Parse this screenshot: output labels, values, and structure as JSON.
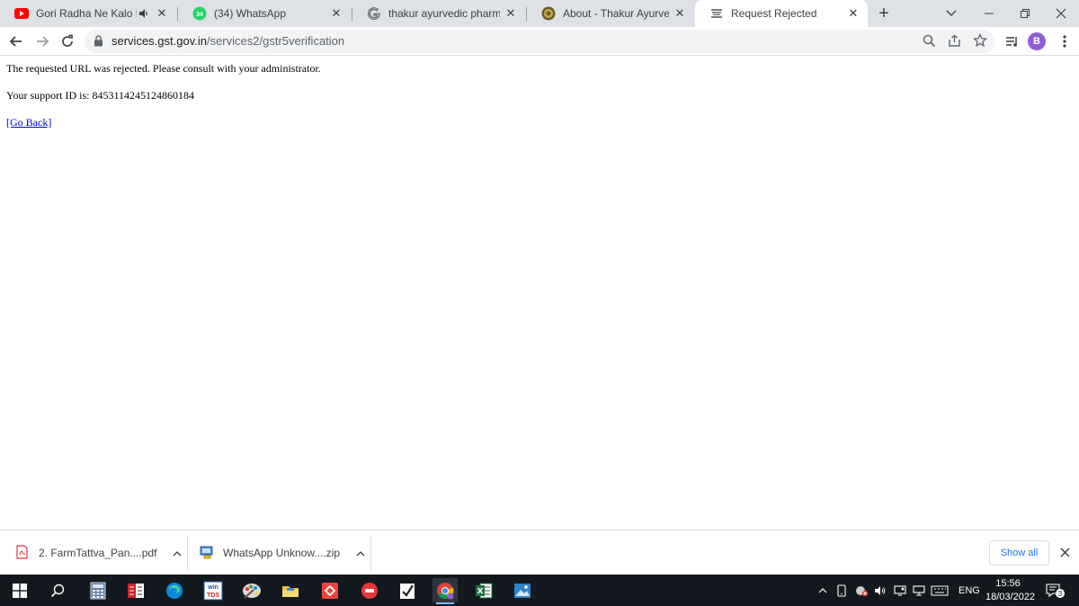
{
  "tabs": [
    {
      "title": "Gori Radha Ne Kalo Kaan"
    },
    {
      "title": "(34) WhatsApp",
      "badge": "34"
    },
    {
      "title": "thakur ayurvedic pharmacy p"
    },
    {
      "title": "About - Thakur Ayurvedic Ph"
    },
    {
      "title": "Request Rejected"
    }
  ],
  "omnibox": {
    "host": "services.gst.gov.in",
    "path": "/services2/gstr5verification"
  },
  "profile": {
    "initial": "B"
  },
  "page": {
    "message": "The requested URL was rejected. Please consult with your administrator.",
    "support_id": "Your support ID is: 8453114245124860184",
    "go_back": "[Go Back]"
  },
  "downloads": [
    {
      "name": "2. FarmTattva_Pan....pdf"
    },
    {
      "name": "WhatsApp Unknow....zip"
    }
  ],
  "shelf": {
    "show_all": "Show all"
  },
  "taskbar": {
    "winTDS_line1": "win",
    "winTDS_line2": "TDS",
    "language": "ENG",
    "time": "15:56",
    "date": "18/03/2022",
    "notifications": "3"
  }
}
